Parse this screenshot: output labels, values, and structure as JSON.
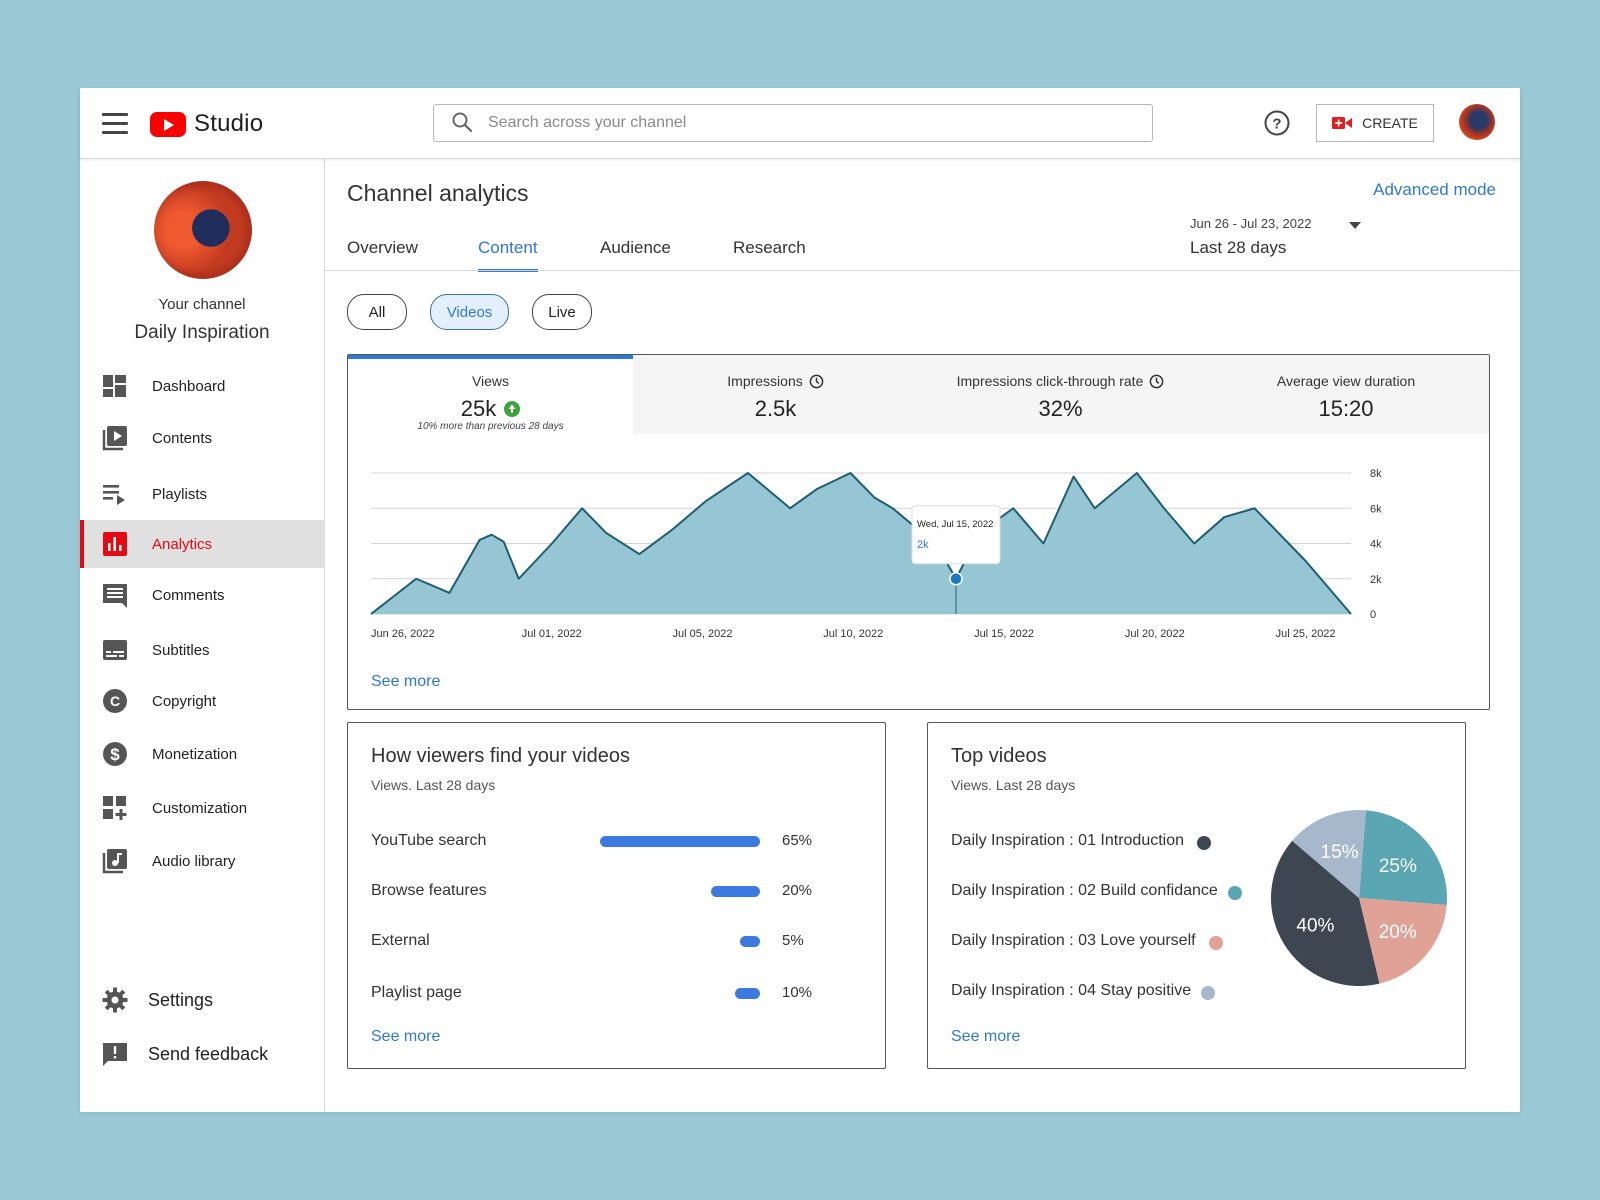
{
  "colors": {
    "brand_red": "#ff0000",
    "accent_blue": "#2f78d4",
    "chart_fill": "#96c6d3",
    "chart_line": "#1d5e73"
  },
  "header": {
    "logo_text": "Studio",
    "search_placeholder": "Search across your channel",
    "create_label": "CREATE"
  },
  "sidebar": {
    "your_channel": "Your channel",
    "channel_name": "Daily Inspiration",
    "items": [
      {
        "label": "Dashboard",
        "icon": "dashboard-icon"
      },
      {
        "label": "Contents",
        "icon": "contents-icon"
      },
      {
        "label": "Playlists",
        "icon": "playlists-icon"
      },
      {
        "label": "Analytics",
        "icon": "analytics-icon",
        "active": true
      },
      {
        "label": "Comments",
        "icon": "comments-icon"
      },
      {
        "label": "Subtitles",
        "icon": "subtitles-icon"
      },
      {
        "label": "Copyright",
        "icon": "copyright-icon"
      },
      {
        "label": "Monetization",
        "icon": "monetization-icon"
      },
      {
        "label": "Customization",
        "icon": "customization-icon"
      },
      {
        "label": "Audio library",
        "icon": "audio-library-icon"
      }
    ],
    "settings": "Settings",
    "feedback": "Send feedback"
  },
  "main": {
    "title": "Channel analytics",
    "advanced": "Advanced mode",
    "date_range": "Jun 26  -  Jul 23, 2022",
    "date_label": "Last 28 days",
    "tabs": [
      "Overview",
      "Content",
      "Audience",
      "Research"
    ],
    "active_tab": "Content",
    "chips": [
      "All",
      "Videos",
      "Live"
    ],
    "active_chip": "Videos"
  },
  "metrics": [
    {
      "name": "Views",
      "value": "25k",
      "note": "10% more than previous 28 days",
      "trend": "up"
    },
    {
      "name": "Impressions",
      "value": "2.5k"
    },
    {
      "name": "Impressions click-through rate",
      "value": "32%"
    },
    {
      "name": "Average view duration",
      "value": "15:20"
    }
  ],
  "chart_data": {
    "type": "area",
    "x_tick_labels": [
      "Jun 26, 2022",
      "Jul 01, 2022",
      "Jul 05, 2022",
      "Jul 10, 2022",
      "Jul 15, 2022",
      "Jul 20, 2022",
      "Jul 25, 2022"
    ],
    "y_tick_labels": [
      "8k",
      "6k",
      "4k",
      "2k",
      "0"
    ],
    "ylim": [
      0,
      8000
    ],
    "grid": true,
    "series": [
      {
        "points": [
          [
            0,
            0
          ],
          [
            1.5,
            2000
          ],
          [
            2.6,
            1200
          ],
          [
            3.6,
            4200
          ],
          [
            4.0,
            4500
          ],
          [
            4.4,
            4100
          ],
          [
            4.9,
            2000
          ],
          [
            6.0,
            4000
          ],
          [
            7.0,
            6000
          ],
          [
            7.8,
            4600
          ],
          [
            8.9,
            3400
          ],
          [
            10.0,
            4800
          ],
          [
            11.1,
            6400
          ],
          [
            12.5,
            8000
          ],
          [
            13.2,
            7000
          ],
          [
            13.9,
            6000
          ],
          [
            14.8,
            7100
          ],
          [
            15.9,
            8000
          ],
          [
            16.7,
            6600
          ],
          [
            17.3,
            6000
          ],
          [
            18.0,
            5000
          ],
          [
            18.8,
            3800
          ],
          [
            19.4,
            2000
          ],
          [
            20.0,
            4000
          ],
          [
            20.5,
            5000
          ],
          [
            21.3,
            6000
          ],
          [
            22.3,
            4000
          ],
          [
            23.3,
            7800
          ],
          [
            24.0,
            6000
          ],
          [
            25.4,
            8000
          ],
          [
            26.3,
            6000
          ],
          [
            27.3,
            4000
          ],
          [
            28.3,
            5500
          ],
          [
            29.3,
            6000
          ],
          [
            31.0,
            3000
          ],
          [
            32.5,
            0
          ]
        ]
      }
    ],
    "tooltip": {
      "date": "Wed, Jul 15, 2022",
      "value": "2k",
      "x": 19.4,
      "y": 2000
    }
  },
  "traffic": {
    "title": "How viewers find your videos",
    "subtitle": "Views. Last 28 days",
    "rows": [
      {
        "name": "YouTube search",
        "pct": "65%",
        "value": 65
      },
      {
        "name": "Browse features",
        "pct": "20%",
        "value": 20
      },
      {
        "name": "External",
        "pct": "5%",
        "value": 5
      },
      {
        "name": "Playlist page",
        "pct": "10%",
        "value": 10
      }
    ],
    "see_more": "See more"
  },
  "top_videos": {
    "title": "Top videos",
    "subtitle": "Views. Last 28 days",
    "rows": [
      {
        "name": "Daily Inspiration : 01 Introduction",
        "color": "#3e4652"
      },
      {
        "name": "Daily Inspiration : 02 Build confidance",
        "color": "#5aa6b2"
      },
      {
        "name": "Daily Inspiration : 03 Love yourself",
        "color": "#e0a196"
      },
      {
        "name": "Daily Inspiration : 04 Stay positive",
        "color": "#a8b8cc"
      }
    ],
    "pie": [
      {
        "label": "25%",
        "value": 25,
        "color": "#5aa6b2"
      },
      {
        "label": "20%",
        "value": 20,
        "color": "#e0a196"
      },
      {
        "label": "40%",
        "value": 40,
        "color": "#3e4652"
      },
      {
        "label": "15%",
        "value": 15,
        "color": "#a8b8cc"
      }
    ],
    "see_more": "See more"
  },
  "see_more": "See more"
}
